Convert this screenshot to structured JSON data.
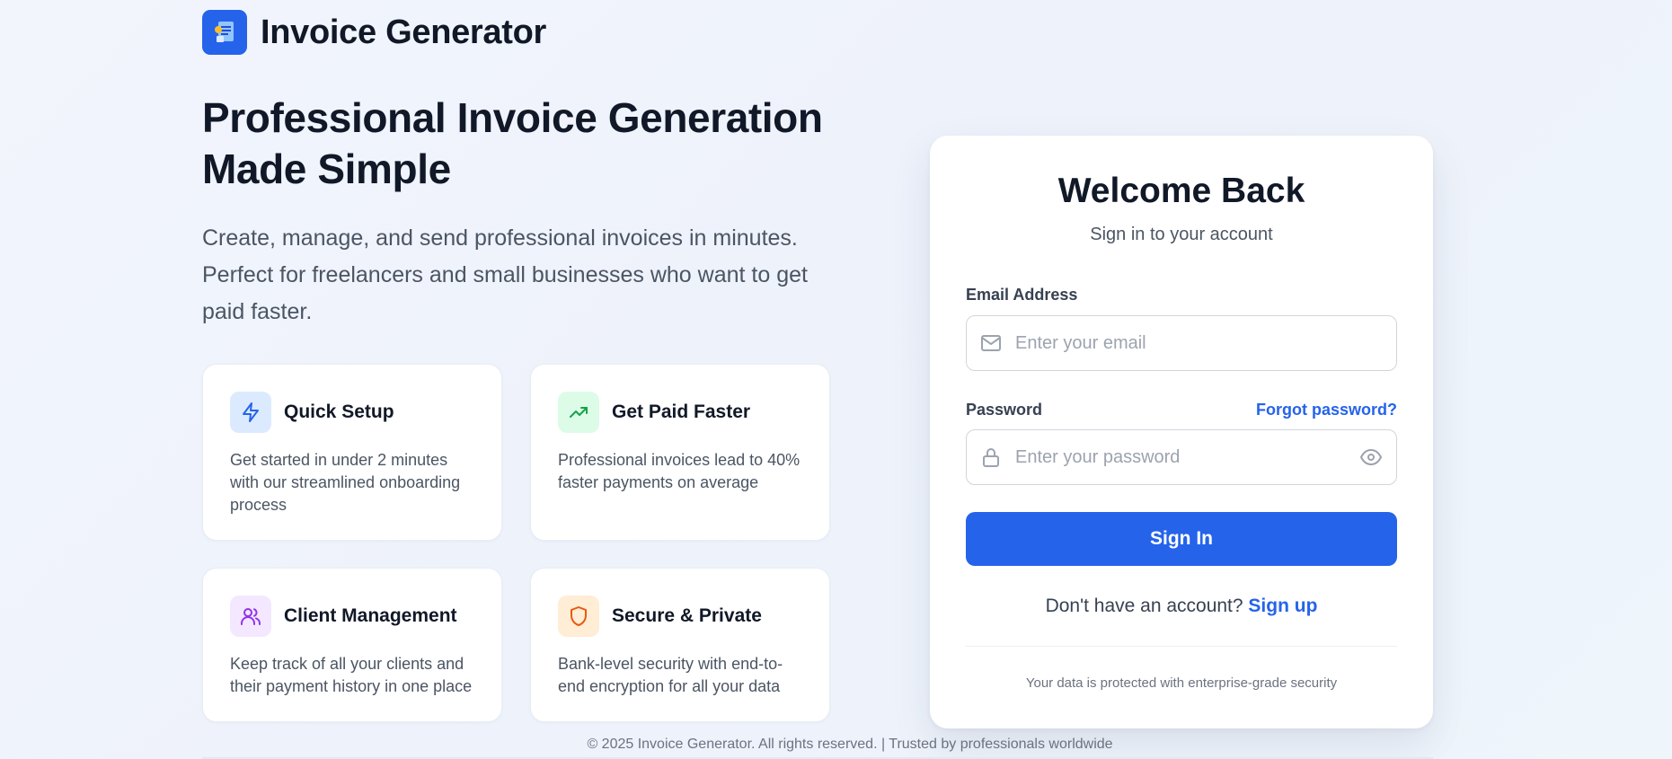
{
  "brand": {
    "name": "Invoice Generator",
    "logo_icon": "invoice-logo-icon",
    "accent": "#2563eb"
  },
  "hero": {
    "title": "Professional Invoice Generation Made Simple",
    "subtitle": "Create, manage, and send professional invoices in minutes. Perfect for freelancers and small businesses who want to get paid faster."
  },
  "features": [
    {
      "icon": "lightning-icon",
      "title": "Quick Setup",
      "desc": "Get started in under 2 minutes with our streamlined onboarding process",
      "icon_color": "#2563eb",
      "icon_bg": "#dbeafe"
    },
    {
      "icon": "trending-up-icon",
      "title": "Get Paid Faster",
      "desc": "Professional invoices lead to 40% faster payments on average",
      "icon_color": "#16a34a",
      "icon_bg": "#dcfce7"
    },
    {
      "icon": "users-icon",
      "title": "Client Management",
      "desc": "Keep track of all your clients and their payment history in one place",
      "icon_color": "#9333ea",
      "icon_bg": "#f3e8ff"
    },
    {
      "icon": "shield-icon",
      "title": "Secure & Private",
      "desc": "Bank-level security with end-to-end encryption for all your data",
      "icon_color": "#ea580c",
      "icon_bg": "#ffedd5"
    }
  ],
  "login": {
    "title": "Welcome Back",
    "subtitle": "Sign in to your account",
    "email_label": "Email Address",
    "email_placeholder": "Enter your email",
    "email_value": "",
    "password_label": "Password",
    "password_placeholder": "Enter your password",
    "password_value": "",
    "forgot_label": "Forgot password?",
    "signin_label": "Sign In",
    "signup_prompt": "Don't have an account?",
    "signup_label": "Sign up",
    "security_note": "Your data is protected with enterprise-grade security"
  },
  "footer": {
    "text": "© 2025 Invoice Generator. All rights reserved. | Trusted by professionals worldwide"
  }
}
